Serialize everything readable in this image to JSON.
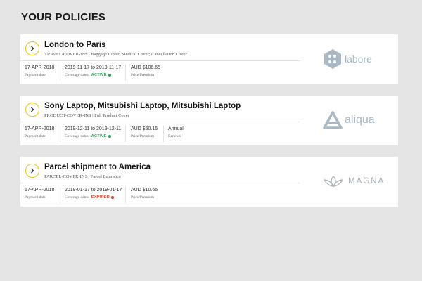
{
  "page": {
    "title": "YOUR POLICIES"
  },
  "labels": {
    "payment_date": "Payment date",
    "coverage_dates": "Coverage dates",
    "price": "Price/Premium",
    "renewal": "Renewal"
  },
  "policies": [
    {
      "title": "London to Paris",
      "type": "TRAVEL-COVER-INS",
      "coverages": "Baggage Cover; Medical Cover; Cancellation Cover",
      "payment_date": "17-APR-2018",
      "coverage_range": "2019-11-17 to 2019-11-17",
      "status": "ACTIVE",
      "price": "AUD $106.65",
      "logo": "labore"
    },
    {
      "title": "Sony Laptop, Mitsubishi Laptop, Mitsubishi Laptop",
      "type": "PRODUCT-COVER-INS",
      "coverages": "Full Product Cover",
      "payment_date": "17-APR-2018",
      "coverage_range": "2019-12-11 to 2019-12-11",
      "status": "ACTIVE",
      "price": "AUD $50.15",
      "renewal": "Annual",
      "logo": "aliqua"
    },
    {
      "title": "Parcel shipment to America",
      "type": "PARCEL-COVER-INS",
      "coverages": "Parcel Insurance",
      "payment_date": "17-APR-2018",
      "coverage_range": "2019-01-17 to 2019-01-17",
      "status": "EXPIRED",
      "price": "AUD $10.65",
      "logo": "MAGNA"
    }
  ],
  "colors": {
    "accent": "#f2c200",
    "active": "#2e9e5b",
    "expired": "#e0412e",
    "logo": "#a9b8c4"
  }
}
